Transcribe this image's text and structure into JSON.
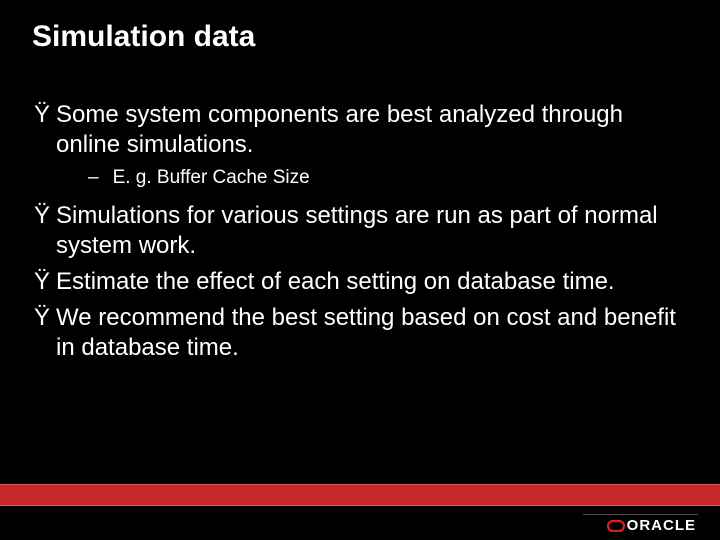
{
  "title": "Simulation data",
  "bullets": [
    {
      "marker": "Ÿ",
      "text": "Some system components are best analyzed through online simulations.",
      "sub": [
        {
          "marker": "–",
          "text": "E. g. Buffer Cache Size"
        }
      ]
    },
    {
      "marker": "Ÿ",
      "text": "Simulations for various settings are run as part of normal system work."
    },
    {
      "marker": "Ÿ",
      "text": "Estimate the effect of each setting on database time."
    },
    {
      "marker": "Ÿ",
      "text": "We recommend the best setting based on cost and benefit in database time."
    }
  ],
  "logo": {
    "brand": "ORACLE"
  }
}
